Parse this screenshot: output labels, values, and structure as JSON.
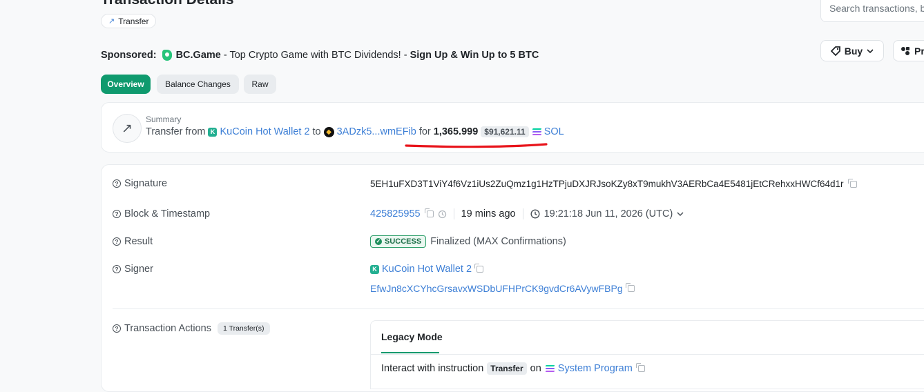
{
  "page": {
    "title": "Transaction Details",
    "type_badge": "Transfer",
    "search_placeholder": "Search transactions, b"
  },
  "sponsored": {
    "label": "Sponsored:",
    "brand": "BC.Game",
    "text": " - Top Crypto Game with BTC Dividends! - ",
    "cta": "Sign Up & Win Up to 5 BTC"
  },
  "header_buttons": {
    "buy": "Buy",
    "pro": "Pro"
  },
  "tabs": [
    {
      "label": "Overview",
      "active": true
    },
    {
      "label": "Balance Changes",
      "active": false
    },
    {
      "label": "Raw",
      "active": false
    }
  ],
  "summary": {
    "label": "Summary",
    "prefix": "Transfer from",
    "from": "KuCoin Hot Wallet 2",
    "to_word": "to",
    "to": "3ADzk5...wmEFib",
    "for_word": "for",
    "amount": "1,365.999",
    "usd": "$91,621.11",
    "token": "SOL"
  },
  "details": {
    "signature": {
      "label": "Signature",
      "value": "5EH1uFXD3T1ViY4f6Vz1iUs2ZuQmz1g1HzTPjuDXJRJsoKZy8xT9mukhV3AERbCa4E5481jEtCRehxxHWCf64d1r"
    },
    "block": {
      "label": "Block & Timestamp",
      "block": "425825955",
      "age": "19 mins ago",
      "timestamp": "19:21:18 Jun 11, 2026 (UTC)"
    },
    "result": {
      "label": "Result",
      "status": "SUCCESS",
      "finality": "Finalized (MAX Confirmations)"
    },
    "signer": {
      "label": "Signer",
      "name": "KuCoin Hot Wallet 2",
      "address": "EfwJn8cXCYhcGrsavxWSDbUFHPrCK9gvdCr6AVywFBPg"
    },
    "actions": {
      "label": "Transaction Actions",
      "count": "1 Transfer(s)",
      "mode_tab": "Legacy Mode",
      "instruction_prefix": "Interact with instruction",
      "instruction": "Transfer",
      "on_word": "on",
      "program": "System Program"
    }
  },
  "colors": {
    "accent": "#0f9a6e",
    "link": "#3d7fd6",
    "annotation": "#e8141b"
  }
}
